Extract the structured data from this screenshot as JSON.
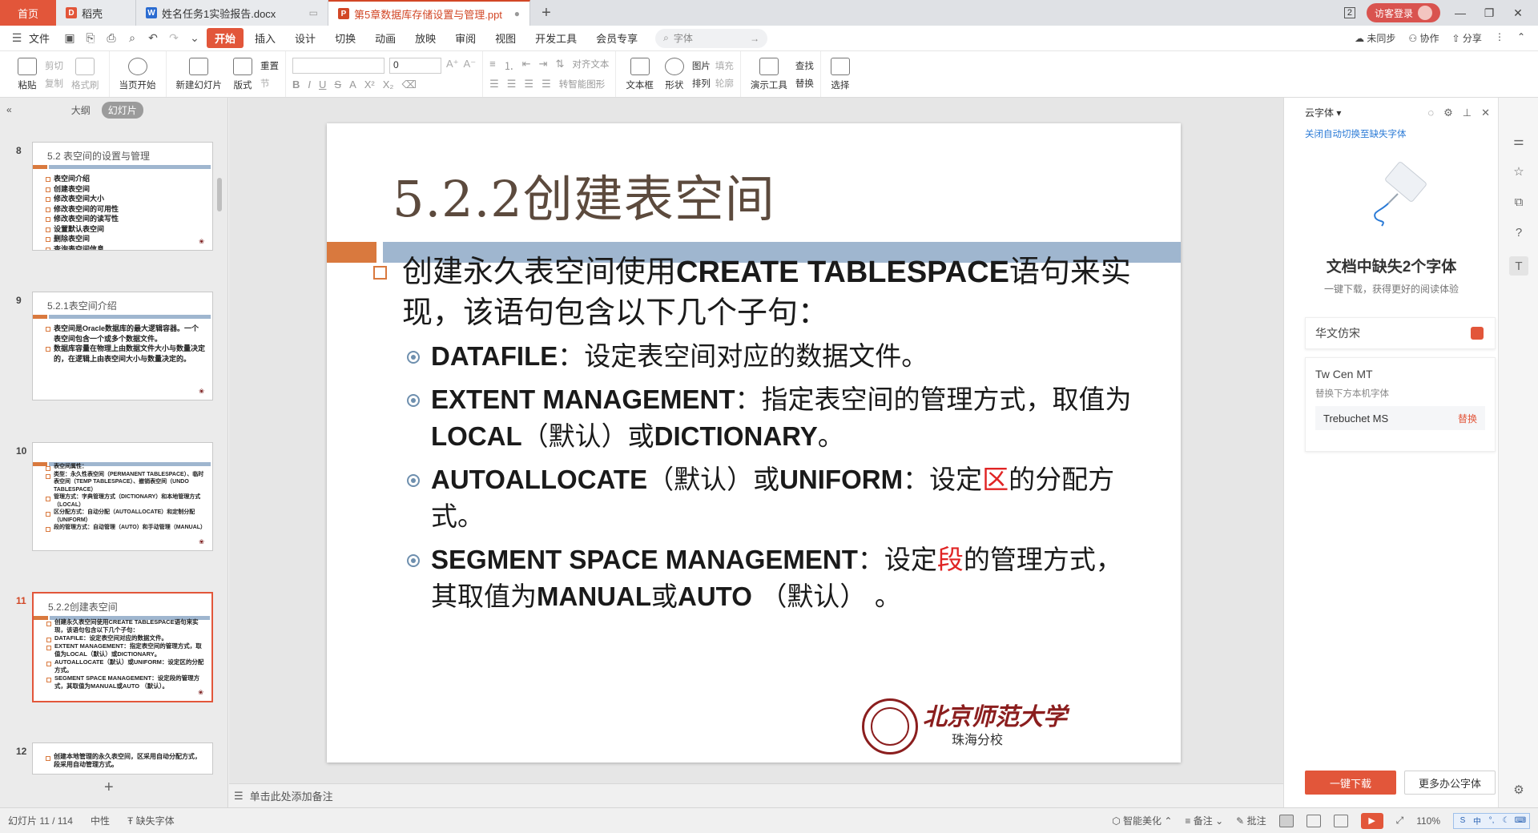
{
  "titlebar": {
    "tabs": [
      {
        "label": "首页"
      },
      {
        "label": "稻壳"
      },
      {
        "label": "姓名任务1实验报告.docx"
      },
      {
        "label": "第5章数据库存储设置与管理.ppt"
      }
    ],
    "badge": "2",
    "login_label": "访客登录"
  },
  "menubar": {
    "file_label": "文件",
    "tabs": [
      "开始",
      "插入",
      "设计",
      "切换",
      "动画",
      "放映",
      "审阅",
      "视图",
      "开发工具",
      "会员专享"
    ],
    "search_placeholder": "字体",
    "right": [
      "未同步",
      "协作",
      "分享"
    ]
  },
  "ribbon": {
    "paste": "粘贴",
    "cut": "剪切",
    "copy": "复制",
    "format_painter": "格式刷",
    "from_start": "当页开始",
    "new_slide": "新建幻灯片",
    "layout": "版式",
    "reset": "重置",
    "section": "节",
    "font_size": "0",
    "text_box": "文本框",
    "shape": "形状",
    "picture": "图片",
    "arrange": "排列",
    "fill": "填充",
    "outline": "轮廓",
    "align_text": "对齐文本",
    "smartart": "转智能图形",
    "presentation_tools": "演示工具",
    "find": "查找",
    "replace": "替换",
    "select": "选择"
  },
  "leftpanel": {
    "outline_tab": "大纲",
    "slides_tab": "幻灯片",
    "slides": [
      {
        "num": "8",
        "title": "5.2 表空间的设置与管理",
        "lines": [
          "表空间介绍",
          "创建表空间",
          "修改表空间大小",
          "修改表空间的可用性",
          "修改表空间的读写性",
          "设置默认表空间",
          "删除表空间",
          "查询表空间信息"
        ]
      },
      {
        "num": "9",
        "title": "5.2.1表空间介绍",
        "lines": [
          "表空间是Oracle数据库的最大逻辑容器。一个表空间包含一个或多个数据文件。",
          "数据库容量在物理上由数据文件大小与数量决定的，在逻辑上由表空间大小与数量决定的。"
        ]
      },
      {
        "num": "10",
        "title": "",
        "lines": [
          "表空间属性：",
          "类型：永久性表空间（PERMANENT TABLESPACE）、临时表空间（TEMP TABLESPACE）、撤销表空间（UNDO TABLESPACE）",
          "管理方式：字典管理方式（DICTIONARY）和本地管理方式（LOCAL）",
          "区分配方式：自动分配（AUTOALLOCATE）和定制分配（UNIFORM）",
          "段的管理方式：自动管理（AUTO）和手动管理（MANUAL）"
        ]
      },
      {
        "num": "11",
        "title": "5.2.2创建表空间",
        "lines": [
          "创建永久表空间使用CREATE TABLESPACE语句来实现，该语句包含以下几个子句：",
          "DATAFILE：设定表空间对应的数据文件。",
          "EXTENT MANAGEMENT：指定表空间的管理方式，取值为LOCAL（默认）或DICTIONARY。",
          "AUTOALLOCATE（默认）或UNIFORM：设定区的分配方式。",
          "SEGMENT SPACE MANAGEMENT：设定段的管理方式，其取值为MANUAL或AUTO （默认）。"
        ]
      },
      {
        "num": "12",
        "title": "",
        "lines": [
          "创建本地管理的永久表空间，区采用自动分配方式，段采用自动管理方式。"
        ]
      }
    ]
  },
  "slide": {
    "title": "5.2.2创建表空间",
    "main_text_1": "创建永久表空间使用",
    "main_text_2": "CREATE TABLESPACE",
    "main_text_3": "语句来实现，该语句包含以下几个子句：",
    "bullets": [
      {
        "en": "DATAFILE",
        "cn": "：设定表空间对应的数据文件。"
      },
      {
        "en": "EXTENT MANAGEMENT",
        "cn": "：指定表空间的管理方式，取值为",
        "en2": "LOCAL",
        "cn2": "（默认）或",
        "en3": "DICTIONARY",
        "cn3": "。"
      },
      {
        "en": "AUTOALLOCATE",
        "cn": "（默认）或",
        "en2": "UNIFORM",
        "cn2": "：设定",
        "red": "区",
        "cn3": "的分配方式。"
      },
      {
        "en": "SEGMENT SPACE MANAGEMENT",
        "cn": "：设定",
        "red": "段",
        "cn2": "的管理方式，其取值为",
        "en2": "MANUAL",
        "cn3": "或",
        "en3": "AUTO",
        "cn4": " （默认） 。"
      }
    ],
    "logo_name": "北京师范大学",
    "logo_sub": "珠海分校"
  },
  "notes_placeholder": "单击此处添加备注",
  "rightpanel": {
    "title": "云字体",
    "link": "关闭自动切换至缺失字体",
    "heading": "文档中缺失2个字体",
    "subtitle": "一键下载，获得更好的阅读体验",
    "font1": "华文仿宋",
    "font2": "Tw Cen MT",
    "font2_hint": "替换下方本机字体",
    "font2_replacement": "Trebuchet MS",
    "replace_label": "替换",
    "download_btn": "一键下载",
    "more_btn": "更多办公字体"
  },
  "statusbar": {
    "slide_counter": "幻灯片 11 / 114",
    "theme": "中性",
    "missing_font": "缺失字体",
    "smart_beautify": "智能美化",
    "notes": "备注",
    "comments": "批注",
    "zoom": "110%"
  },
  "colors": {
    "accent": "#e2563a",
    "slide_orange": "#d9793e",
    "slide_blue": "#9fb6cf",
    "logo_red": "#8b1e1e"
  }
}
